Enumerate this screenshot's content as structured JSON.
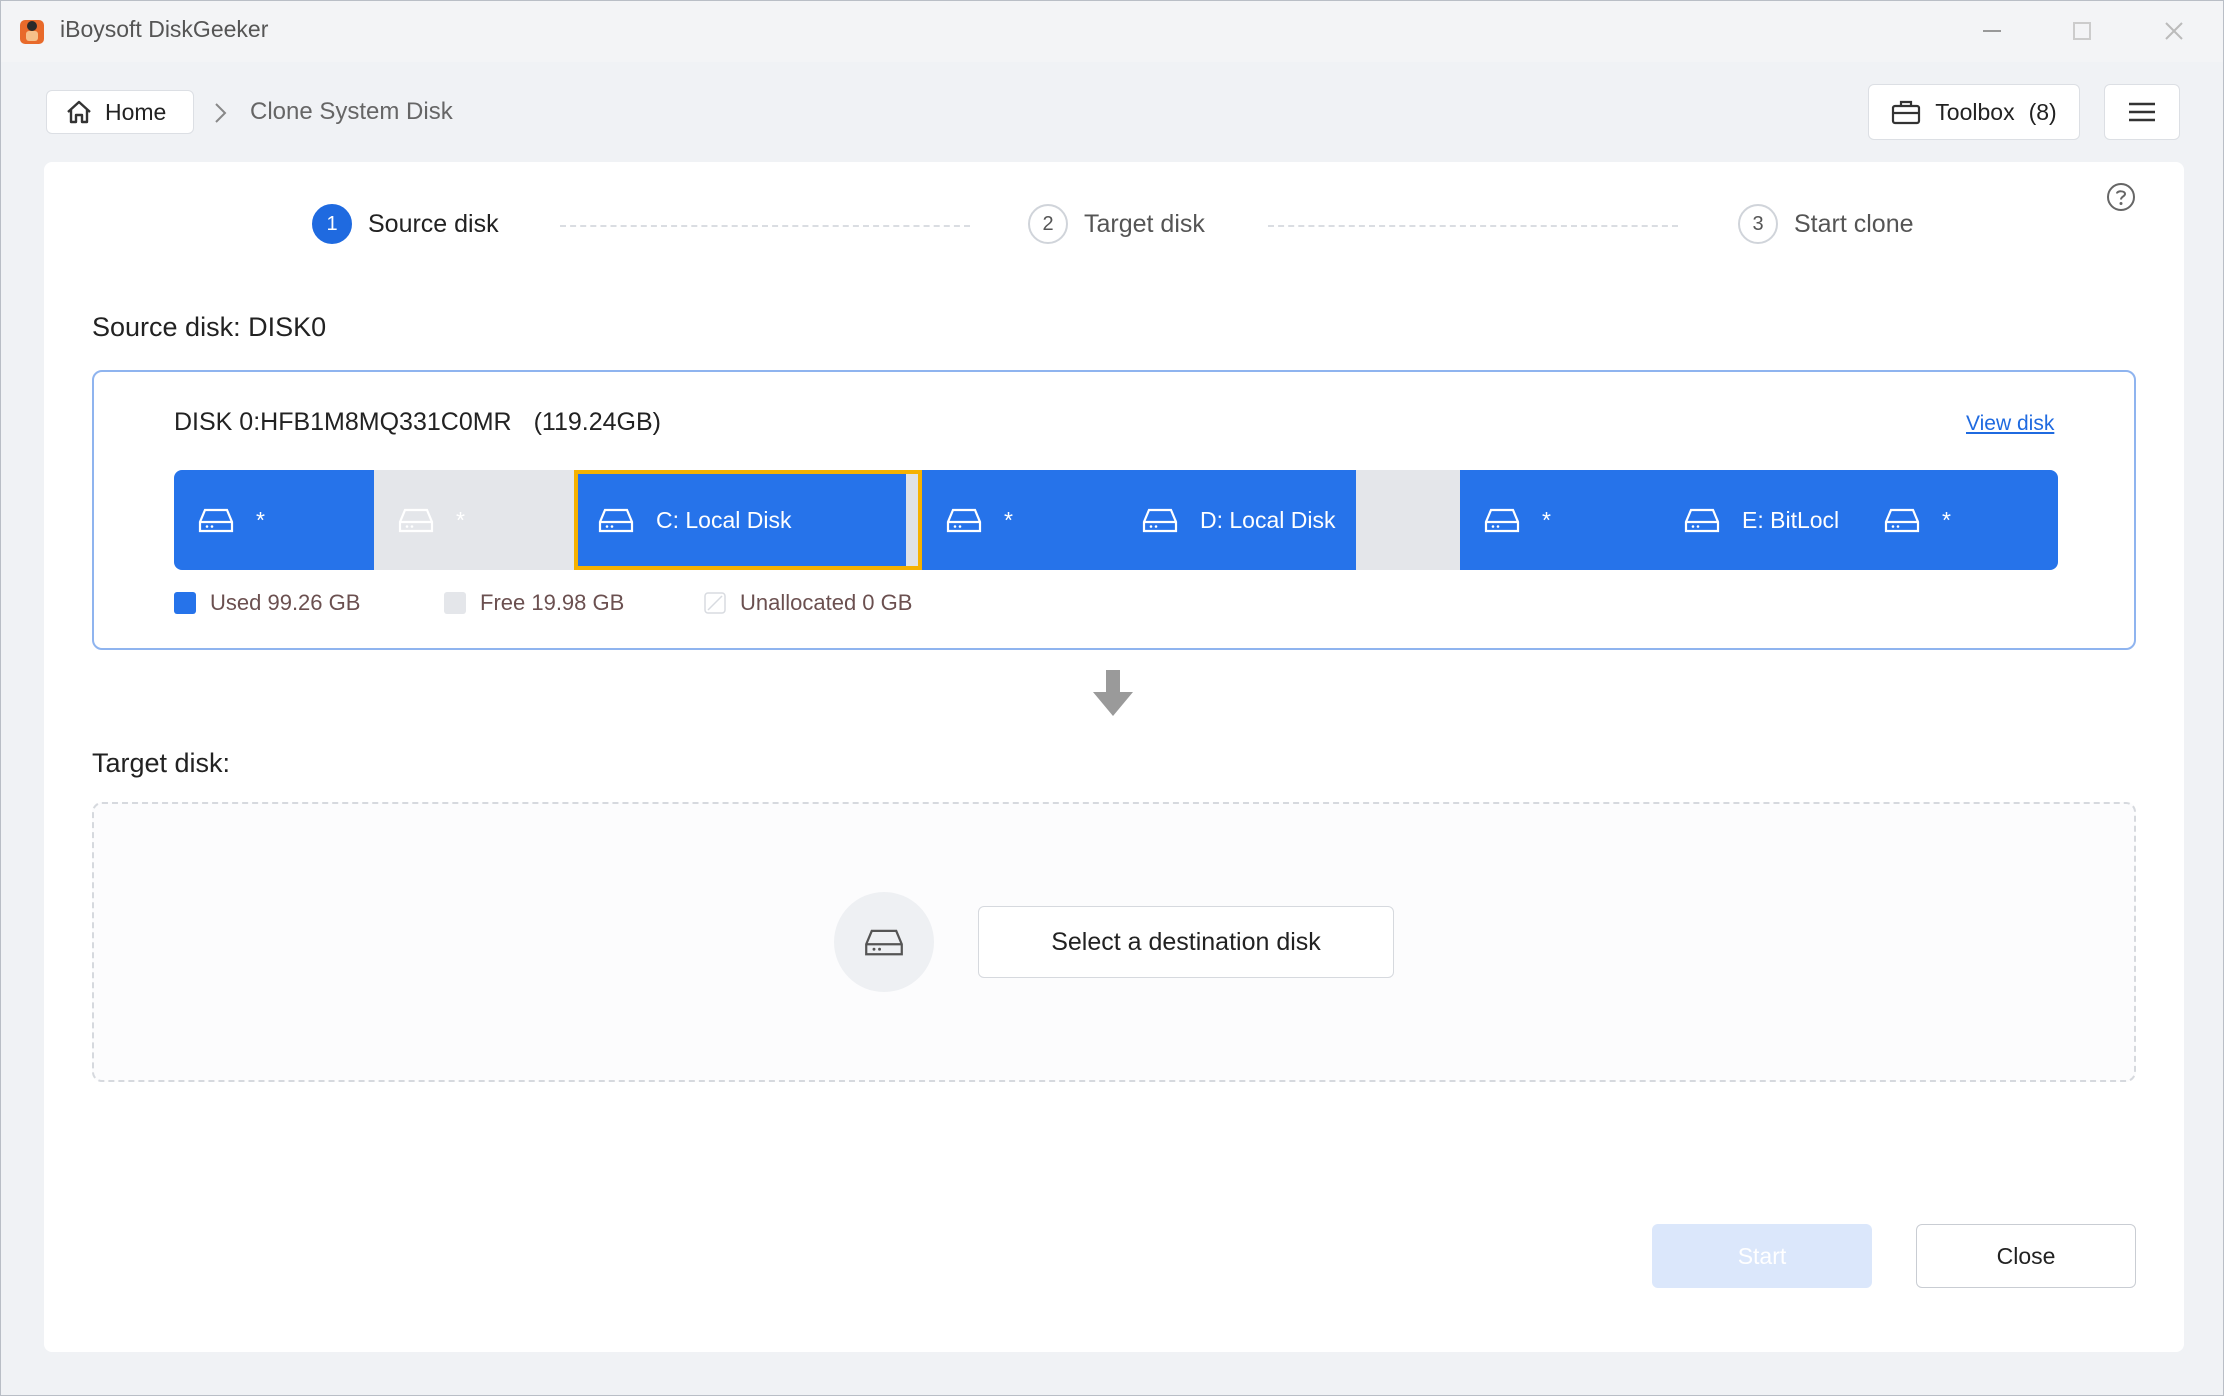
{
  "window": {
    "title": "iBoysoft DiskGeeker"
  },
  "nav": {
    "home_label": "Home",
    "breadcrumb_current": "Clone System Disk",
    "toolbox_label": "Toolbox",
    "toolbox_count": "(8)"
  },
  "steps": [
    {
      "number": "1",
      "label": "Source disk",
      "active": true
    },
    {
      "number": "2",
      "label": "Target disk",
      "active": false
    },
    {
      "number": "3",
      "label": "Start clone",
      "active": false
    }
  ],
  "source": {
    "section_label": "Source disk:",
    "section_value": "DISK0",
    "disk_name": "DISK 0:HFB1M8MQ331C0MR",
    "disk_size": "(119.24GB)",
    "view_disk_link": "View disk",
    "partitions": [
      {
        "label": "*",
        "state": "used"
      },
      {
        "label": "*",
        "state": "free"
      },
      {
        "label": "C: Local Disk",
        "state": "used",
        "selected": true
      },
      {
        "label": "*",
        "state": "used"
      },
      {
        "label": "D: Local Disk",
        "state": "used"
      },
      {
        "label": "",
        "state": "free"
      },
      {
        "label": "*",
        "state": "used"
      },
      {
        "label": "E: BitLocl",
        "state": "used"
      },
      {
        "label": "*",
        "state": "used"
      }
    ],
    "legend": {
      "used": "Used 99.26 GB",
      "free": "Free 19.98 GB",
      "unallocated": "Unallocated 0 GB"
    }
  },
  "target": {
    "section_label": "Target disk:",
    "select_button": "Select a destination disk"
  },
  "footer": {
    "start_label": "Start",
    "close_label": "Close"
  },
  "colors": {
    "accent": "#1f6ae0",
    "partition_used": "#2673ea",
    "partition_free": "#e4e6ea",
    "selected_border": "#f5b100",
    "start_disabled": "#dbe7fb"
  },
  "icons": {
    "app_logo": "app-logo-icon",
    "home": "home-icon",
    "chevron": "chevron-right-icon",
    "toolbox": "toolbox-icon",
    "menu": "hamburger-menu-icon",
    "help": "help-icon",
    "drive": "drive-icon",
    "arrow": "arrow-down-icon"
  }
}
